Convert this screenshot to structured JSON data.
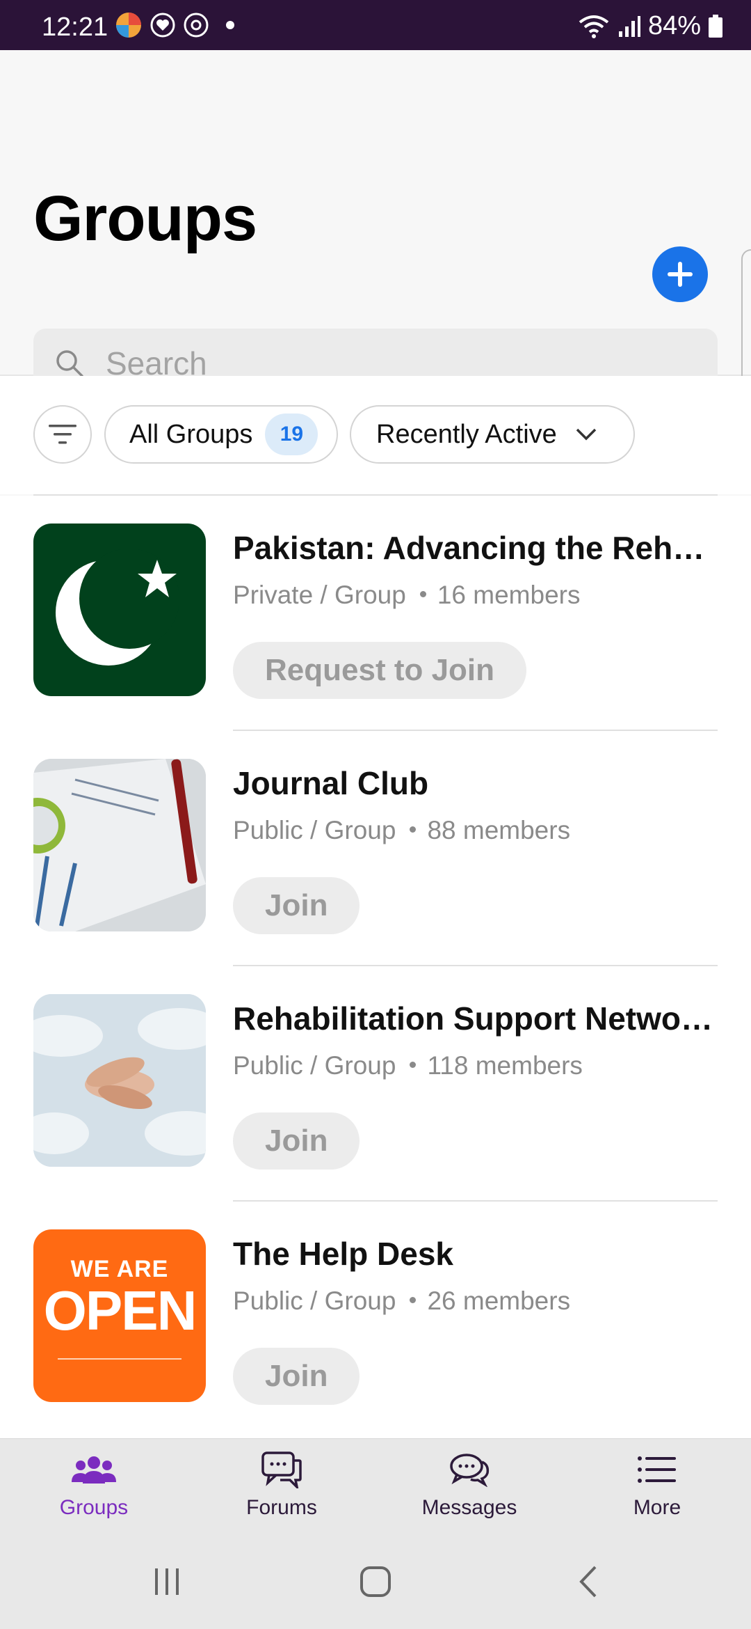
{
  "status_bar": {
    "time": "12:21",
    "battery": "84%"
  },
  "header": {
    "title": "Groups",
    "search_placeholder": "Search"
  },
  "filters": {
    "all_groups_label": "All Groups",
    "all_groups_count": "19",
    "sort_label": "Recently Active"
  },
  "groups": [
    {
      "title": "Pakistan: Advancing the Rehab…",
      "privacy": "Private / Group",
      "members": "16 members",
      "action": "Request to Join"
    },
    {
      "title": "Journal Club",
      "privacy": "Public / Group",
      "members": "88 members",
      "action": "Join"
    },
    {
      "title": "Rehabilitation Support Networ…",
      "privacy": "Public / Group",
      "members": "118 members",
      "action": "Join"
    },
    {
      "title": "The Help Desk",
      "privacy": "Public / Group",
      "members": "26 members",
      "action": "Join",
      "thumb_text_top": "WE ARE",
      "thumb_text_main": "OPEN"
    }
  ],
  "bottom_nav": [
    {
      "label": "Groups",
      "icon": "groups-icon",
      "active": true
    },
    {
      "label": "Forums",
      "icon": "forums-icon"
    },
    {
      "label": "Messages",
      "icon": "messages-icon"
    },
    {
      "label": "More",
      "icon": "menu-icon"
    }
  ],
  "colors": {
    "accent": "#1a73e8",
    "active_nav": "#7b2cbf",
    "status_bar": "#2b1338"
  }
}
